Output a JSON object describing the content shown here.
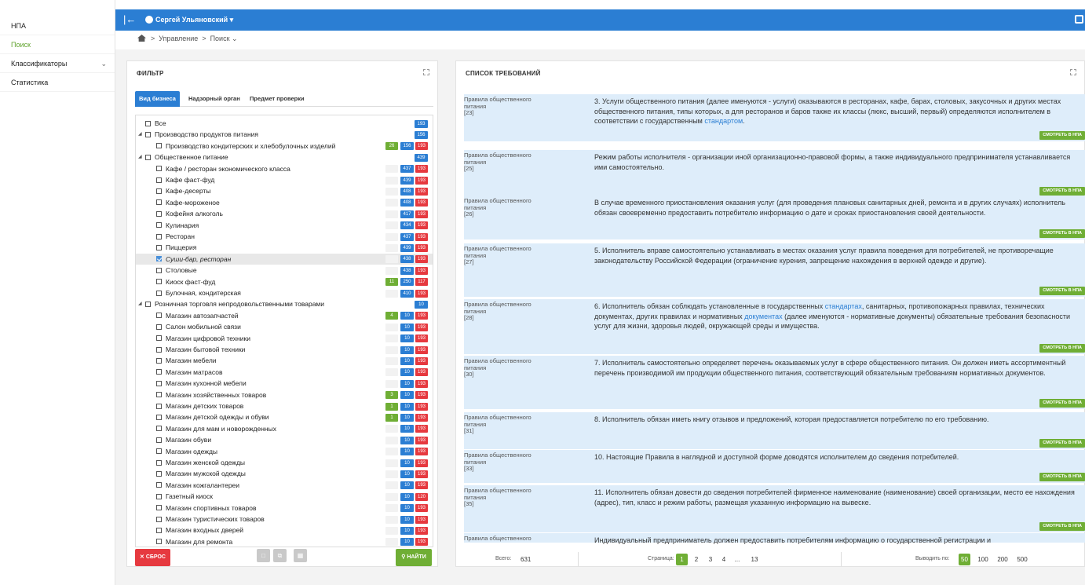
{
  "sidebar": {
    "items": [
      {
        "label": "НПА"
      },
      {
        "label": "Поиск"
      },
      {
        "label": "Классификаторы"
      },
      {
        "label": "Статистика"
      }
    ]
  },
  "topbar": {
    "user": "Сергей Ульяновский"
  },
  "breadcrumb": {
    "items": [
      "Управление",
      "Поиск"
    ]
  },
  "filter": {
    "title": "ФИЛЬТР",
    "tabs": [
      "Вид бизнеса",
      "Надзорный орган",
      "Предмет проверки"
    ],
    "tree": [
      {
        "label": "Все",
        "level": 0,
        "badges": [
          "193"
        ]
      },
      {
        "label": "Производство продуктов питания",
        "level": 0,
        "expandable": true,
        "badges": [
          "156"
        ]
      },
      {
        "label": "Производство кондитерских и хлебобулочных изделий",
        "level": 1,
        "badges": [
          "26",
          "156",
          "193"
        ]
      },
      {
        "label": "Общественное питание",
        "level": 0,
        "expandable": true,
        "badges": [
          "439"
        ]
      },
      {
        "label": "Кафе / ресторан экономического класса",
        "level": 1,
        "badges": [
          "",
          "437",
          "193"
        ]
      },
      {
        "label": "Кафе фаст-фуд",
        "level": 1,
        "badges": [
          "",
          "439",
          "193"
        ]
      },
      {
        "label": "Кафе-десерты",
        "level": 1,
        "badges": [
          "",
          "408",
          "193"
        ]
      },
      {
        "label": "Кафе-мороженое",
        "level": 1,
        "badges": [
          "",
          "408",
          "193"
        ]
      },
      {
        "label": "Кофейня алкоголь",
        "level": 1,
        "badges": [
          "",
          "417",
          "193"
        ]
      },
      {
        "label": "Кулинария",
        "level": 1,
        "badges": [
          "",
          "434",
          "193"
        ]
      },
      {
        "label": "Ресторан",
        "level": 1,
        "badges": [
          "",
          "437",
          "193"
        ]
      },
      {
        "label": "Пиццерия",
        "level": 1,
        "badges": [
          "",
          "439",
          "193"
        ]
      },
      {
        "label": "Суши-бар, ресторан",
        "level": 1,
        "checked": true,
        "badges": [
          "",
          "438",
          "193"
        ]
      },
      {
        "label": "Столовые",
        "level": 1,
        "badges": [
          "",
          "438",
          "193"
        ]
      },
      {
        "label": "Киоск фаст-фуд",
        "level": 1,
        "badges": [
          "11",
          "250",
          "117"
        ]
      },
      {
        "label": "Булочная, кондитерская",
        "level": 1,
        "badges": [
          "",
          "410",
          "193"
        ]
      },
      {
        "label": "Розничная торговля непродовольственными товарами",
        "level": 0,
        "expandable": true,
        "badges": [
          "10"
        ]
      },
      {
        "label": "Магазин автозапчастей",
        "level": 1,
        "badges": [
          "4",
          "10",
          "193"
        ]
      },
      {
        "label": "Салон мобильной связи",
        "level": 1,
        "badges": [
          "",
          "10",
          "193"
        ]
      },
      {
        "label": "Магазин цифровой техники",
        "level": 1,
        "badges": [
          "",
          "10",
          "193"
        ]
      },
      {
        "label": "Магазин бытовой техники",
        "level": 1,
        "badges": [
          "",
          "10",
          "193"
        ]
      },
      {
        "label": "Магазин мебели",
        "level": 1,
        "badges": [
          "",
          "10",
          "193"
        ]
      },
      {
        "label": "Магазин матрасов",
        "level": 1,
        "badges": [
          "",
          "10",
          "193"
        ]
      },
      {
        "label": "Магазин кухонной мебели",
        "level": 1,
        "badges": [
          "",
          "10",
          "193"
        ]
      },
      {
        "label": "Магазин хозяйственных товаров",
        "level": 1,
        "badges": [
          "3",
          "10",
          "193"
        ]
      },
      {
        "label": "Магазин детских товаров",
        "level": 1,
        "badges": [
          "1",
          "10",
          "193"
        ]
      },
      {
        "label": "Магазин детской одежды и обуви",
        "level": 1,
        "badges": [
          "1",
          "10",
          "193"
        ]
      },
      {
        "label": "Магазин для мам и новорожденных",
        "level": 1,
        "badges": [
          "",
          "10",
          "193"
        ]
      },
      {
        "label": "Магазин обуви",
        "level": 1,
        "badges": [
          "",
          "10",
          "193"
        ]
      },
      {
        "label": "Магазин одежды",
        "level": 1,
        "badges": [
          "",
          "10",
          "193"
        ]
      },
      {
        "label": "Магазин женской одежды",
        "level": 1,
        "badges": [
          "",
          "10",
          "193"
        ]
      },
      {
        "label": "Магазин мужской одежды",
        "level": 1,
        "badges": [
          "",
          "10",
          "193"
        ]
      },
      {
        "label": "Магазин кожгалантереи",
        "level": 1,
        "badges": [
          "",
          "10",
          "193"
        ]
      },
      {
        "label": "Газетный киоск",
        "level": 1,
        "badges": [
          "",
          "10",
          "120"
        ]
      },
      {
        "label": "Магазин спортивных товаров",
        "level": 1,
        "badges": [
          "",
          "10",
          "193"
        ]
      },
      {
        "label": "Магазин туристических товаров",
        "level": 1,
        "badges": [
          "",
          "10",
          "193"
        ]
      },
      {
        "label": "Магазин входных дверей",
        "level": 1,
        "badges": [
          "",
          "10",
          "193"
        ]
      },
      {
        "label": "Магазин для ремонта",
        "level": 1,
        "badges": [
          "",
          "10",
          "193"
        ]
      }
    ],
    "reset_label": "СБРОС",
    "find_label": "НАЙТИ"
  },
  "requirements": {
    "title": "СПИСОК ТРЕБОВАНИЙ",
    "view_label": "СМОТРЕТЬ В НПА",
    "items": [
      {
        "src": "Правила общественного питания",
        "num": "[23]",
        "text": "3. Услуги общественного питания (далее именуются - услуги) оказываются в ресторанах, кафе, барах, столовых, закусочных и других местах общественного питания, типы которых, а для ресторанов и баров также их классы (люкс, высший, первый) определяются исполнителем в соответствии с государственным ",
        "link": "стандартом",
        "tail": "."
      },
      {
        "src": "Правила общественного питания",
        "num": "[25]",
        "text": "Режим работы исполнителя - организации иной организационно-правовой формы, а также индивидуального предпринимателя устанавливается ими самостоятельно."
      },
      {
        "src": "Правила общественного питания",
        "num": "[26]",
        "text": "В случае временного приостановления оказания услуг (для проведения плановых санитарных дней, ремонта и в других случаях) исполнитель обязан своевременно предоставить потребителю информацию о дате и сроках приостановления своей деятельности."
      },
      {
        "src": "Правила общественного питания",
        "num": "[27]",
        "text": "5. Исполнитель вправе самостоятельно устанавливать в местах оказания услуг правила поведения для потребителей, не противоречащие законодательству Российской Федерации (ограничение курения, запрещение нахождения в верхней одежде и другие)."
      },
      {
        "src": "Правила общественного питания",
        "num": "[28]",
        "text": "6. Исполнитель обязан соблюдать установленные в государственных ",
        "link": "стандартах",
        "tail": ", санитарных, противопожарных правилах, технических документах, других правилах и нормативных ",
        "link2": "документах",
        "tail2": " (далее именуются - нормативные документы) обязательные требования безопасности услуг для жизни, здоровья людей, окружающей среды и имущества."
      },
      {
        "src": "Правила общественного питания",
        "num": "[30]",
        "text": "7. Исполнитель самостоятельно определяет перечень оказываемых услуг в сфере общественного питания. Он должен иметь ассортиментный перечень производимой им продукции общественного питания, соответствующий обязательным требованиям нормативных документов."
      },
      {
        "src": "Правила общественного питания",
        "num": "[31]",
        "text": "8. Исполнитель обязан иметь книгу отзывов и предложений, которая предоставляется потребителю по его требованию."
      },
      {
        "src": "Правила общественного питания",
        "num": "[33]",
        "text": "10. Настоящие Правила в наглядной и доступной форме доводятся исполнителем до сведения потребителей."
      },
      {
        "src": "Правила общественного питания",
        "num": "[35]",
        "text": "11. Исполнитель обязан довести до сведения потребителей фирменное наименование (наименование) своей организации, место ее нахождения (адрес), тип, класс и режим работы, размещая указанную информацию на вывеске."
      },
      {
        "src": "Правила общественного",
        "num": "",
        "text": "Индивидуальный предприниматель должен предоставить потребителям информацию о государственной регистрации и"
      }
    ]
  },
  "footer": {
    "total_label": "Всего:",
    "total": "631",
    "page_label": "Страница:",
    "pages": [
      "1",
      "2",
      "3",
      "4",
      "...",
      "13"
    ],
    "per_page_label": "Выводить по:",
    "per_page": [
      "50",
      "100",
      "200",
      "500"
    ]
  },
  "colors": {
    "primary": "#2b7ed3",
    "green": "#6fae35",
    "red": "#e6393f",
    "row_bg": "#deedfa"
  }
}
